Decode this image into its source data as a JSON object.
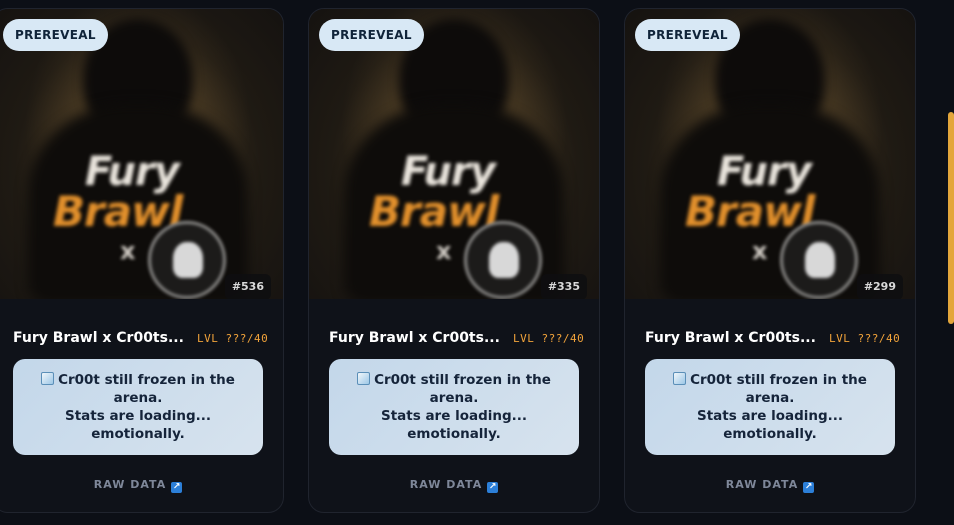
{
  "cards": [
    {
      "badge": "PREREVEAL",
      "number": "#536",
      "title": "Fury Brawl x Cr00ts...",
      "level": "LVL ???/40",
      "art": {
        "word1": "Fury",
        "word2": "Brawl",
        "x": "x"
      },
      "status_lines": [
        "Cr00t still frozen in the",
        "arena.",
        "Stats are loading...",
        "emotionally."
      ],
      "link_label": "RAW DATA"
    },
    {
      "badge": "PREREVEAL",
      "number": "#335",
      "title": "Fury Brawl x Cr00ts...",
      "level": "LVL ???/40",
      "art": {
        "word1": "Fury",
        "word2": "Brawl",
        "x": "x"
      },
      "status_lines": [
        "Cr00t still frozen in the",
        "arena.",
        "Stats are loading...",
        "emotionally."
      ],
      "link_label": "RAW DATA"
    },
    {
      "badge": "PREREVEAL",
      "number": "#299",
      "title": "Fury Brawl x Cr00ts...",
      "level": "LVL ???/40",
      "art": {
        "word1": "Fury",
        "word2": "Brawl",
        "x": "x"
      },
      "status_lines": [
        "Cr00t still frozen in the",
        "arena.",
        "Stats are loading...",
        "emotionally."
      ],
      "link_label": "RAW DATA"
    }
  ],
  "icons": {
    "status": "ice-cube-icon",
    "link": "external-link-icon"
  },
  "colors": {
    "accent": "#f0a23a",
    "badge_bg": "#d8e8f5",
    "status_bg": "#c3d7ea",
    "link_icon": "#2c7fd8"
  }
}
